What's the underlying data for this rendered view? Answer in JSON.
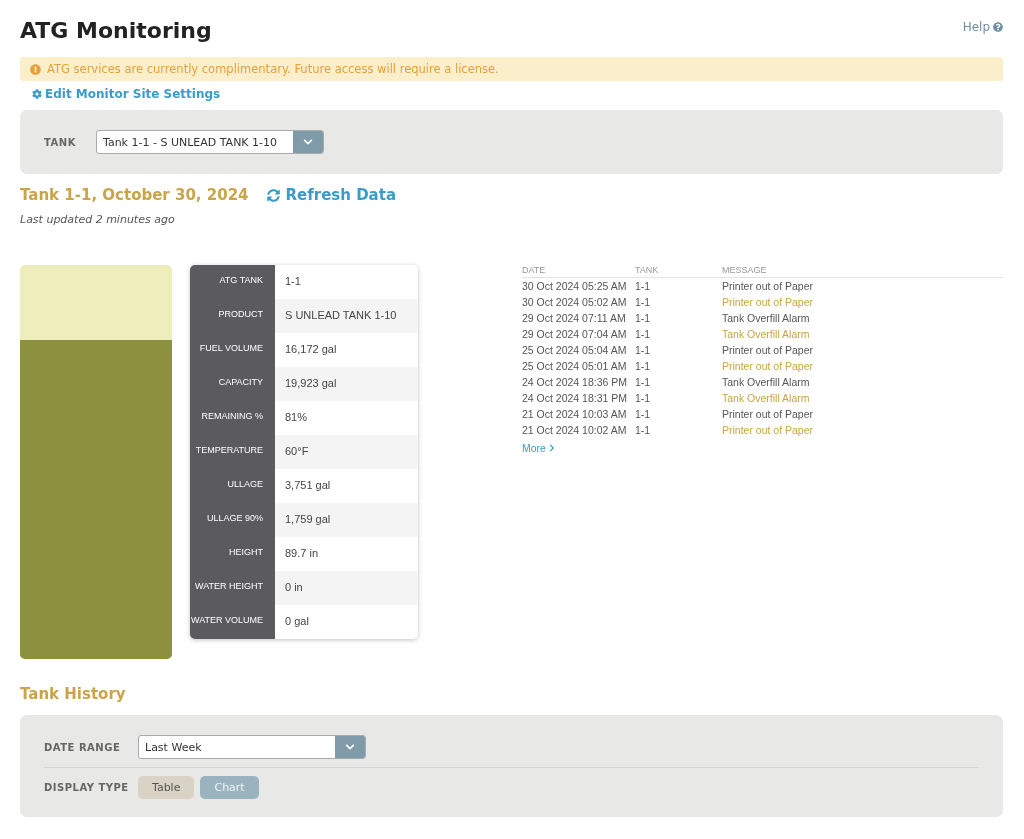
{
  "page": {
    "title": "ATG Monitoring",
    "help_link": "Help"
  },
  "notice": {
    "text": "ATG services are currently complimentary. Future access will require a license."
  },
  "settings_link": "Edit Monitor Site Settings",
  "tank_filter": {
    "label": "TANK",
    "value": "Tank 1-1 - S UNLEAD TANK 1-10"
  },
  "heading": {
    "title": "Tank 1-1, October 30, 2024",
    "refresh": "Refresh Data",
    "updated": "Last updated 2 minutes ago"
  },
  "gauge": {
    "level": 0.81
  },
  "details": [
    {
      "label": "ATG TANK",
      "value": "1-1"
    },
    {
      "label": "PRODUCT",
      "value": "S UNLEAD TANK 1-10"
    },
    {
      "label": "FUEL VOLUME",
      "value": "16,172 gal"
    },
    {
      "label": "CAPACITY",
      "value": "19,923 gal"
    },
    {
      "label": "REMAINING %",
      "value": "81%"
    },
    {
      "label": "TEMPERATURE",
      "value": "60°F"
    },
    {
      "label": "ULLAGE",
      "value": "3,751 gal"
    },
    {
      "label": "ULLAGE 90%",
      "value": "1,759 gal"
    },
    {
      "label": "HEIGHT",
      "value": "89.7 in"
    },
    {
      "label": "WATER HEIGHT",
      "value": "0 in"
    },
    {
      "label": "WATER VOLUME",
      "value": "0 gal"
    }
  ],
  "alarms": {
    "columns": [
      "DATE",
      "TANK",
      "MESSAGE"
    ],
    "rows": [
      {
        "date": "30 Oct 2024 05:25 AM",
        "tank": "1-1",
        "message": "Printer out of Paper",
        "color": "#555555"
      },
      {
        "date": "30 Oct 2024 05:02 AM",
        "tank": "1-1",
        "message": "Printer out of Paper",
        "color": "#c9a449"
      },
      {
        "date": "29 Oct 2024 07:11 AM",
        "tank": "1-1",
        "message": "Tank Overfill Alarm",
        "color": "#555555"
      },
      {
        "date": "29 Oct 2024 07:04 AM",
        "tank": "1-1",
        "message": "Tank Overfill Alarm",
        "color": "#c9a449"
      },
      {
        "date": "25 Oct 2024 05:04 AM",
        "tank": "1-1",
        "message": "Printer out of Paper",
        "color": "#555555"
      },
      {
        "date": "25 Oct 2024 05:01 AM",
        "tank": "1-1",
        "message": "Printer out of Paper",
        "color": "#c9a449"
      },
      {
        "date": "24 Oct 2024 18:36 PM",
        "tank": "1-1",
        "message": "Tank Overfill Alarm",
        "color": "#555555"
      },
      {
        "date": "24 Oct 2024 18:31 PM",
        "tank": "1-1",
        "message": "Tank Overfill Alarm",
        "color": "#c9a449"
      },
      {
        "date": "21 Oct 2024 10:03 AM",
        "tank": "1-1",
        "message": "Printer out of Paper",
        "color": "#555555"
      },
      {
        "date": "21 Oct 2024 10:02 AM",
        "tank": "1-1",
        "message": "Printer out of Paper",
        "color": "#c9a449"
      }
    ],
    "more": "More"
  },
  "history": {
    "title": "Tank History",
    "date_range": {
      "label": "DATE RANGE",
      "value": "Last Week"
    },
    "display_type": {
      "label": "DISPLAY TYPE",
      "options": [
        {
          "label": "Table",
          "selected": true
        },
        {
          "label": "Chart",
          "selected": false
        }
      ]
    }
  }
}
